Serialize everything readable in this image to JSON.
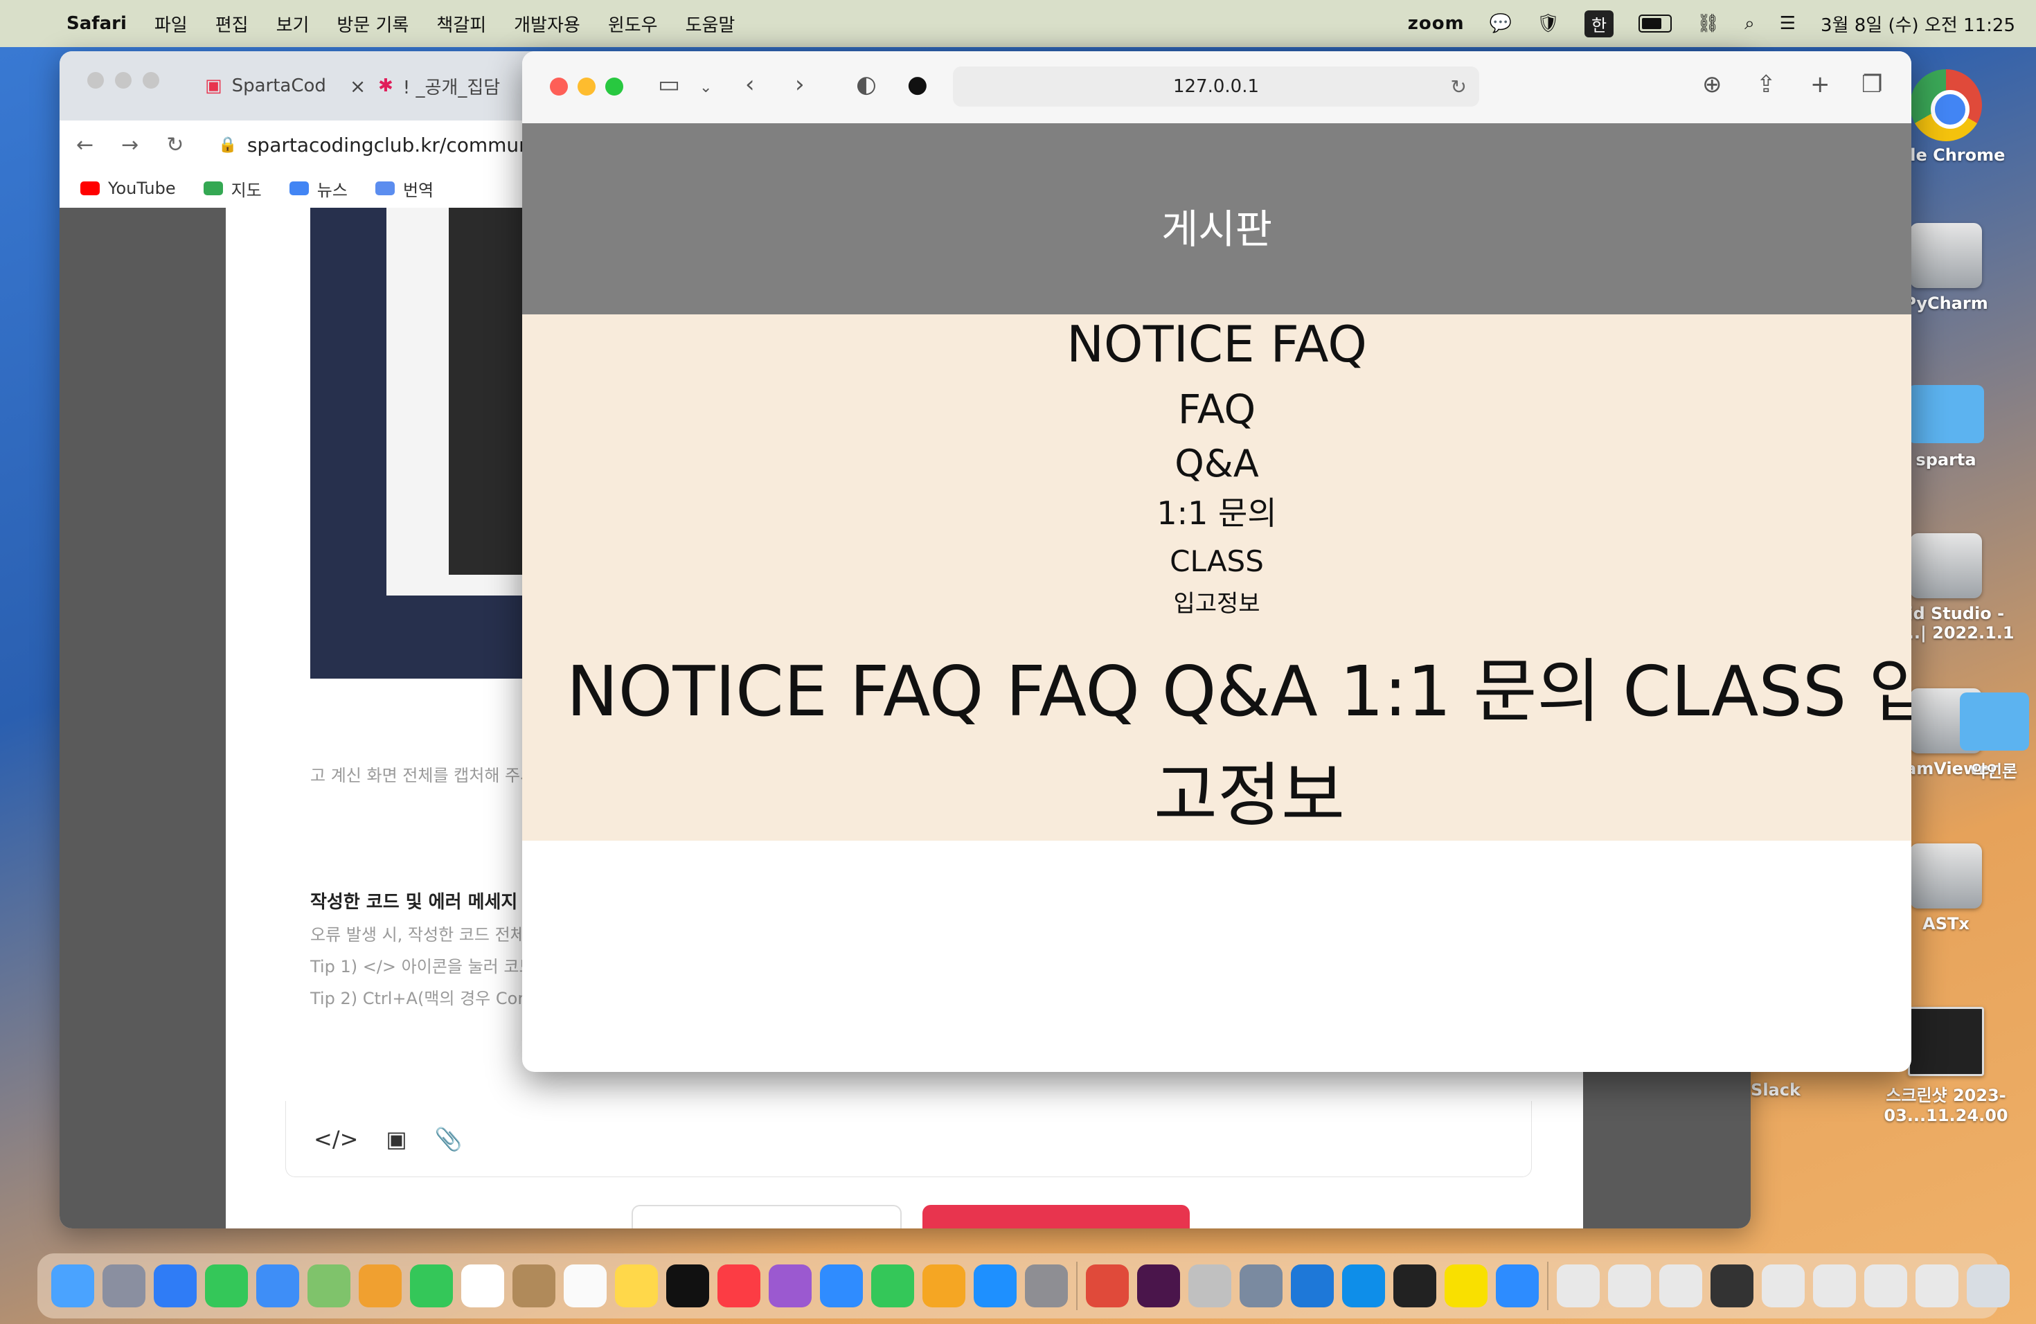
{
  "menubar": {
    "app": "Safari",
    "items": [
      "파일",
      "편집",
      "보기",
      "방문 기록",
      "책갈피",
      "개발자용",
      "윈도우",
      "도움말"
    ],
    "zoom": "zoom",
    "input_source": "한",
    "datetime": "3월 8일 (수) 오전 11:25"
  },
  "desktop": {
    "icons": [
      "ogle Chrome",
      "PyCharm",
      "sparta",
      "roid Studio - ric...| 2022.1.1",
      "eamViewer",
      "ASTx",
      "스크린샷 2023-03...11.24.00",
      "Slack",
      "악인론"
    ]
  },
  "chrome": {
    "tabs": [
      "SpartaCod",
      "! _공개_집담"
    ],
    "url": "spartacodingclub.kr/commun",
    "bookmarks": [
      "YouTube",
      "지도",
      "뉴스",
      "번역"
    ],
    "page": {
      "caption": "고 계신 화면 전체를 캡처해 주시",
      "section_title": "작성한 코드 및 에러 메세지",
      "hint1": "오류 발생 시, 작성한 코드 전체와",
      "hint2": "Tip 1) </> 아이콘을 눌러 코드박",
      "hint3": "Tip 2) Ctrl+A(맥의 경우 Comm",
      "editor_tools": [
        "</>",
        "▣",
        "📎"
      ]
    }
  },
  "safari": {
    "url": "127.0.0.1",
    "header": "게시판",
    "menu": [
      "NOTICE FAQ",
      "FAQ",
      "Q&A",
      "1:1 문의",
      "CLASS",
      "입고정보"
    ],
    "menu_big": "NOTICE FAQ FAQ Q&A 1:1 문의 CLASS 입고정보"
  },
  "colors": {
    "header_bg": "#808080",
    "menu_bg": "#f8ebdb",
    "accent_red": "#e8344e"
  }
}
